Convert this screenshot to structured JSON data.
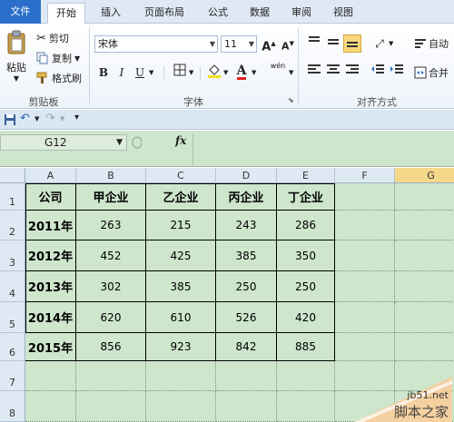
{
  "tabs": [
    {
      "key": "file",
      "label": "文件"
    },
    {
      "key": "home",
      "label": "开始"
    },
    {
      "key": "insert",
      "label": "插入"
    },
    {
      "key": "layout",
      "label": "页面布局"
    },
    {
      "key": "formula",
      "label": "公式"
    },
    {
      "key": "data",
      "label": "数据"
    },
    {
      "key": "review",
      "label": "审阅"
    },
    {
      "key": "view",
      "label": "视图"
    }
  ],
  "ribbon": {
    "clipboard": {
      "paste": "粘贴",
      "cut": "剪切",
      "copy": "复制",
      "format_painter": "格式刷",
      "label": "剪贴板"
    },
    "font": {
      "name": "宋体",
      "size": "11",
      "grow": "A",
      "shrink": "A",
      "bold": "B",
      "italic": "I",
      "underline": "U",
      "label": "字体",
      "phonetic": "wén"
    },
    "alignment": {
      "wrap": "自动",
      "merge": "合并",
      "label": "对齐方式"
    }
  },
  "formula_bar": {
    "name_box": "G12",
    "fx": "fx",
    "value": ""
  },
  "sheet": {
    "columns": [
      "A",
      "B",
      "C",
      "D",
      "E",
      "F",
      "G"
    ],
    "selected_column": "G",
    "rows": [
      "1",
      "2",
      "3",
      "4",
      "5",
      "6",
      "7",
      "8"
    ],
    "table": {
      "header": [
        "公司",
        "甲企业",
        "乙企业",
        "丙企业",
        "丁企业"
      ],
      "body": [
        [
          "2011年",
          "263",
          "215",
          "243",
          "286"
        ],
        [
          "2012年",
          "452",
          "425",
          "385",
          "350"
        ],
        [
          "2013年",
          "302",
          "385",
          "250",
          "250"
        ],
        [
          "2014年",
          "620",
          "610",
          "526",
          "420"
        ],
        [
          "2015年",
          "856",
          "923",
          "842",
          "885"
        ]
      ]
    }
  },
  "watermark": {
    "site": "jb51.net",
    "name": "脚本之家"
  },
  "colors": {
    "sheet_bg": "#cde6cc",
    "file_tab": "#2a6fc9",
    "selected_header": "#f5d88a"
  }
}
